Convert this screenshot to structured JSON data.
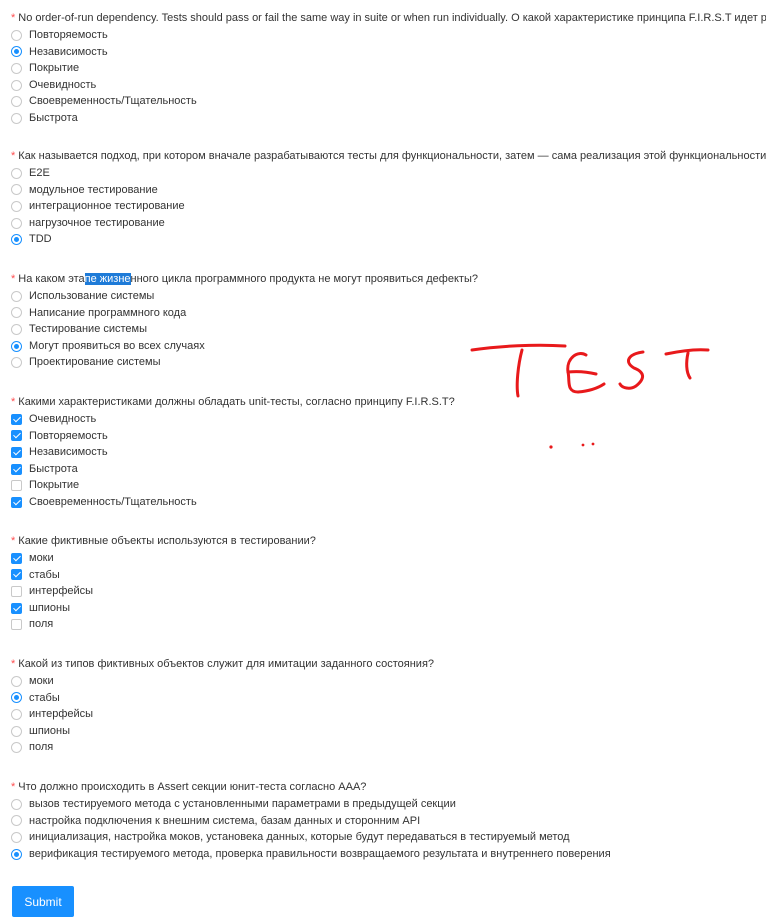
{
  "questions": [
    {
      "required_mark": "*",
      "title": "No order-of-run dependency. Tests should pass or fail the same way in suite or when run individually. О какой характеристике принципа F.I.R.S.T идет речь?",
      "type": "radio",
      "options": [
        {
          "label": "Повторяемость",
          "checked": false
        },
        {
          "label": "Независимость",
          "checked": true
        },
        {
          "label": "Покрытие",
          "checked": false
        },
        {
          "label": "Очевидность",
          "checked": false
        },
        {
          "label": "Своевременность/Тщательность",
          "checked": false
        },
        {
          "label": "Быстрота",
          "checked": false
        }
      ]
    },
    {
      "required_mark": "*",
      "title": "Как называется подход, при котором вначале разрабатываются тесты для функциональности, затем — сама реализация этой функциональности",
      "type": "radio",
      "options": [
        {
          "label": "E2E",
          "checked": false
        },
        {
          "label": "модульное тестирование",
          "checked": false
        },
        {
          "label": "интеграционное тестирование",
          "checked": false
        },
        {
          "label": "нагрузочное тестирование",
          "checked": false
        },
        {
          "label": "TDD",
          "checked": true
        }
      ]
    },
    {
      "required_mark": "*",
      "title_before": "На каком эта",
      "title_highlight": "пе жизне",
      "title_after": "нного цикла программного продукта не могут проявиться дефекты?",
      "type": "radio",
      "options": [
        {
          "label": "Использование системы",
          "checked": false
        },
        {
          "label": "Написание программного кода",
          "checked": false
        },
        {
          "label": "Тестирование системы",
          "checked": false
        },
        {
          "label": "Могут проявиться во всех случаях",
          "checked": true
        },
        {
          "label": "Проектирование системы",
          "checked": false
        }
      ]
    },
    {
      "required_mark": "*",
      "title": "Какими характеристиками должны обладать unit-тесты, согласно принципу F.I.R.S.T?",
      "type": "checkbox",
      "options": [
        {
          "label": "Очевидность",
          "checked": true
        },
        {
          "label": "Повторяемость",
          "checked": true
        },
        {
          "label": "Независимость",
          "checked": true
        },
        {
          "label": "Быстрота",
          "checked": true
        },
        {
          "label": "Покрытие",
          "checked": false
        },
        {
          "label": "Своевременность/Тщательность",
          "checked": true
        }
      ]
    },
    {
      "required_mark": "*",
      "title": "Какие фиктивные объекты используются в тестировании?",
      "type": "checkbox",
      "options": [
        {
          "label": "моки",
          "checked": true
        },
        {
          "label": "стабы",
          "checked": true
        },
        {
          "label": "интерфейсы",
          "checked": false
        },
        {
          "label": "шпионы",
          "checked": true
        },
        {
          "label": "поля",
          "checked": false
        }
      ]
    },
    {
      "required_mark": "*",
      "title": "Какой из типов фиктивных объектов служит для имитации заданного состояния?",
      "type": "radio",
      "options": [
        {
          "label": "моки",
          "checked": false
        },
        {
          "label": "стабы",
          "checked": true
        },
        {
          "label": "интерфейсы",
          "checked": false
        },
        {
          "label": "шпионы",
          "checked": false
        },
        {
          "label": "поля",
          "checked": false
        }
      ]
    },
    {
      "required_mark": "*",
      "title": "Что должно происходить в Assert секции юнит-теста согласно AAA?",
      "type": "radio",
      "options": [
        {
          "label": "вызов тестируемого метода с установленными параметрами в предыдущей секции",
          "checked": false
        },
        {
          "label": "настройка подключения к внешним система, базам данных и сторонним API",
          "checked": false
        },
        {
          "label": "инициализация, настройка моков, установека данных, которые будут передаваться в тестируемый метод",
          "checked": false
        },
        {
          "label": "верификация тестируемого метода, проверка правильности возвращаемого результата и внутреннего поверения",
          "checked": true
        }
      ]
    }
  ],
  "submit_label": "Submit",
  "colors": {
    "accent": "#1890ff",
    "required": "#ff4d4f",
    "scribble": "#e8191b"
  }
}
